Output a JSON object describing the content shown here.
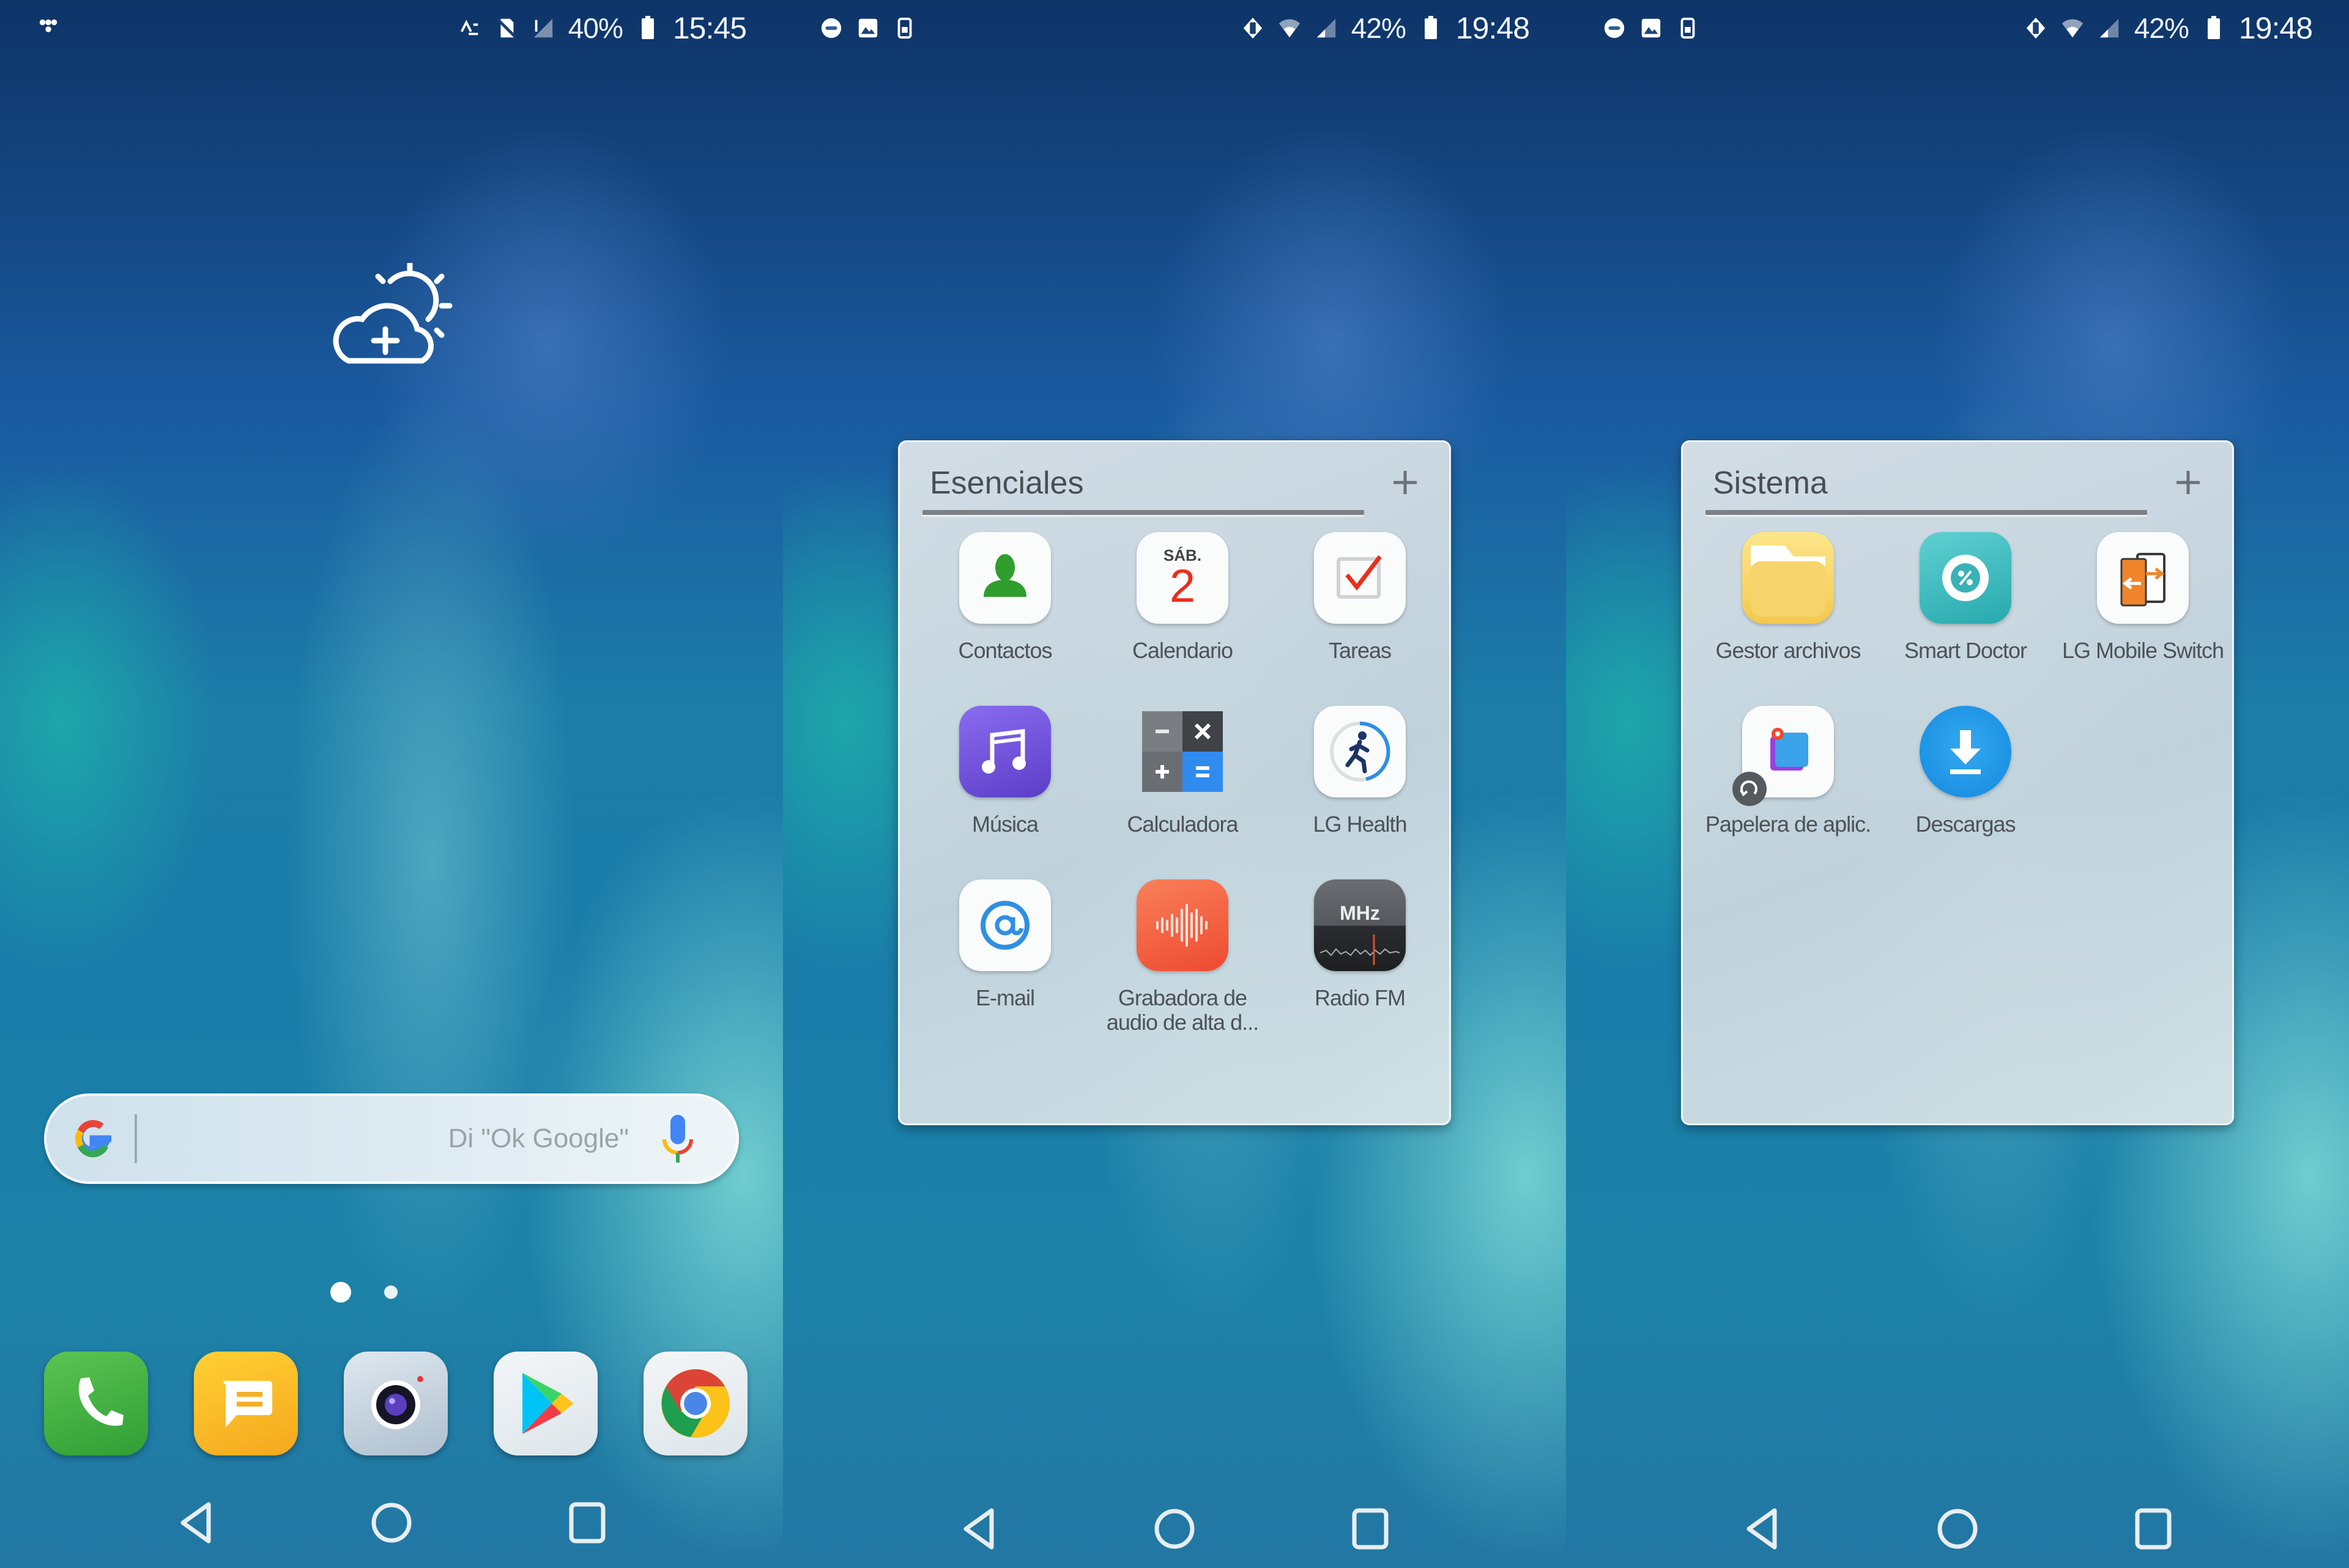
{
  "screens": [
    {
      "status_bar": {
        "left_icons": [
          "notification-dots-icon"
        ],
        "right_icons": [
          "data-sync-icon",
          "no-sim-icon",
          "signal-icon"
        ],
        "battery": "40%",
        "time": "15:45"
      },
      "weather_widget": {
        "icon": "weather-add-icon"
      },
      "search": {
        "placeholder": "Di \"Ok Google\"",
        "value": ""
      },
      "page_indicator": {
        "pages": 2,
        "current": 1
      },
      "dock": [
        {
          "name": "Teléfono",
          "icon": "phone-icon",
          "color": "#3fae3c"
        },
        {
          "name": "Mensajes",
          "icon": "message-icon",
          "color": "#f7b820"
        },
        {
          "name": "Cámara",
          "icon": "camera-icon",
          "color": "#c8d6e2"
        },
        {
          "name": "Play Store",
          "icon": "play-store-icon",
          "color": "#e9eef2"
        },
        {
          "name": "Chrome",
          "icon": "chrome-icon",
          "color": "#e9eef2"
        }
      ],
      "nav": [
        "back",
        "home",
        "recents"
      ]
    },
    {
      "status_bar": {
        "left_icons": [
          "messenger-icon",
          "gallery-icon",
          "sim-icon"
        ],
        "right_icons": [
          "vibrate-icon",
          "wifi-icon",
          "signal-icon"
        ],
        "battery": "42%",
        "time": "19:48"
      },
      "folder": {
        "title": "Esenciales",
        "apps": [
          {
            "label": "Contactos",
            "icon": "contacts-icon"
          },
          {
            "label": "Calendario",
            "icon": "calendar-icon",
            "day_label": "SÁB.",
            "day_number": "2"
          },
          {
            "label": "Tareas",
            "icon": "tasks-icon"
          },
          {
            "label": "Música",
            "icon": "music-icon"
          },
          {
            "label": "Calculadora",
            "icon": "calculator-icon"
          },
          {
            "label": "LG Health",
            "icon": "health-icon"
          },
          {
            "label": "E-mail",
            "icon": "email-icon"
          },
          {
            "label": "Grabadora de audio de alta d...",
            "icon": "voice-recorder-icon"
          },
          {
            "label": "Radio FM",
            "icon": "radio-icon",
            "badge_text": "MHz"
          }
        ]
      },
      "nav": [
        "back",
        "home",
        "recents"
      ]
    },
    {
      "status_bar": {
        "left_icons": [
          "messenger-icon",
          "gallery-icon",
          "sim-icon"
        ],
        "right_icons": [
          "vibrate-icon",
          "wifi-icon",
          "signal-icon"
        ],
        "battery": "42%",
        "time": "19:48"
      },
      "folder": {
        "title": "Sistema",
        "apps": [
          {
            "label": "Gestor archivos",
            "icon": "file-manager-icon"
          },
          {
            "label": "Smart Doctor",
            "icon": "smart-doctor-icon"
          },
          {
            "label": "LG Mobile Switch",
            "icon": "mobile-switch-icon"
          },
          {
            "label": "Papelera de aplic.",
            "icon": "app-trash-icon"
          },
          {
            "label": "Descargas",
            "icon": "downloads-icon"
          }
        ]
      },
      "nav": [
        "back",
        "home",
        "recents"
      ]
    }
  ]
}
